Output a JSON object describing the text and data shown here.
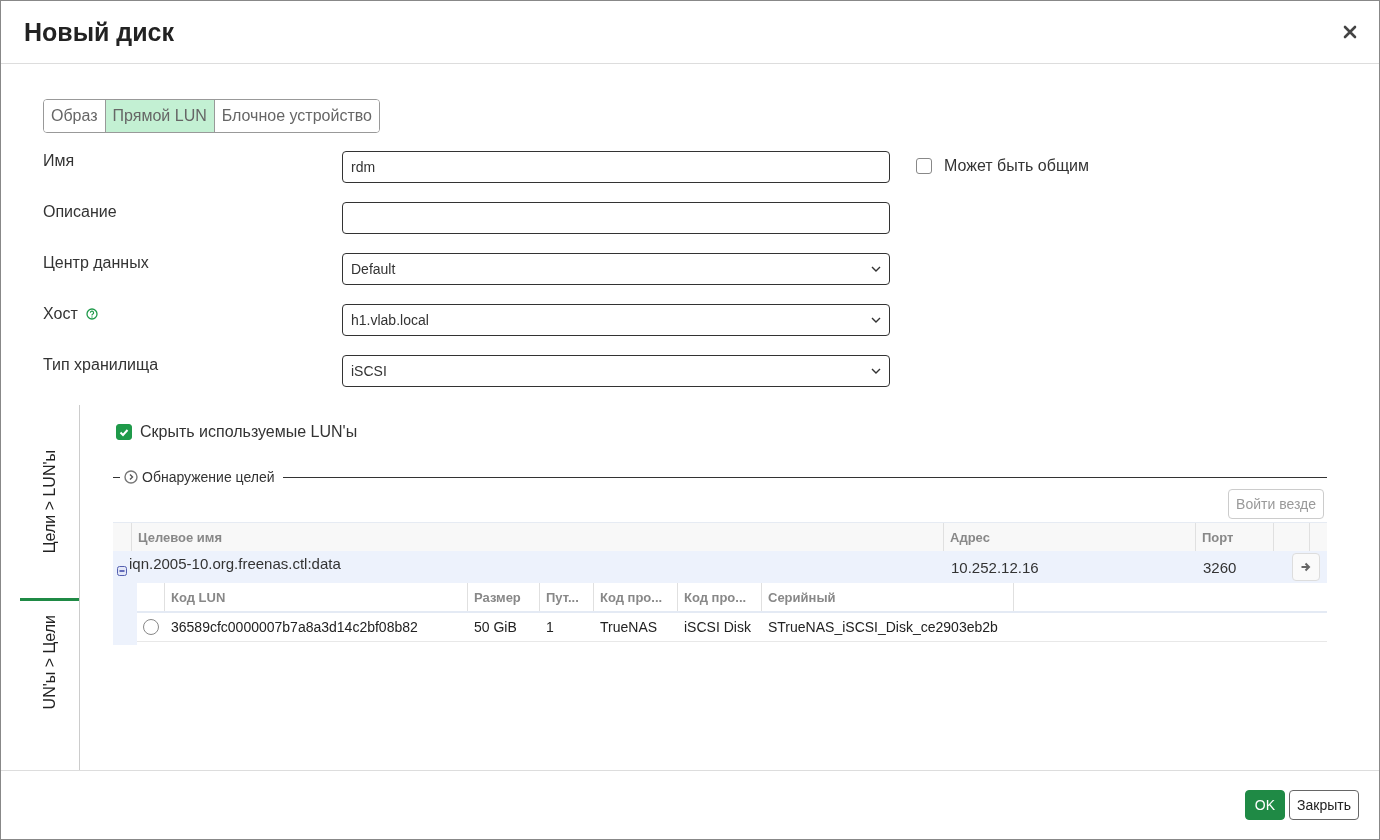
{
  "window": {
    "title": "Новый диск"
  },
  "disk_type_tabs": [
    {
      "label": "Образ",
      "selected": false
    },
    {
      "label": "Прямой LUN",
      "selected": true
    },
    {
      "label": "Блочное устройство",
      "selected": false
    }
  ],
  "form": {
    "fields": [
      {
        "label": "Имя",
        "kind": "text",
        "value": "rdm"
      },
      {
        "label": "Описание",
        "kind": "text"
      },
      {
        "label": "Центр данных",
        "kind": "select",
        "value": "Default"
      },
      {
        "label": "Хост",
        "kind": "select",
        "value": "h1.vlab.local",
        "help": true
      },
      {
        "label": "Тип хранилища",
        "kind": "select",
        "value": "iSCSI"
      }
    ],
    "shareable": {
      "label": "Может быть общим",
      "checked": false
    }
  },
  "side_tabs": [
    {
      "label": "Цели > LUN'ы",
      "selected": true
    },
    {
      "label": "UN'ы > Цели",
      "selected": false
    }
  ],
  "hide_used": {
    "label": "Скрыть используемые LUN'ы",
    "checked": true
  },
  "discovery": {
    "label": "Обнаружение целей",
    "expanded": false
  },
  "login_all_button": {
    "label": "Войти везде",
    "disabled": true
  },
  "targets": {
    "columns": [
      "Целевое имя",
      "Адрес",
      "Порт"
    ],
    "rows": [
      {
        "name": "iqn.2005-10.org.freenas.ctl:data",
        "address": "10.252.12.16",
        "port": "3260",
        "expanded": true,
        "luns": {
          "columns": [
            "Код LUN",
            "Размер",
            "Пут...",
            "Код про...",
            "Код про...",
            "Серийный"
          ],
          "rows": [
            {
              "selected": false,
              "cells": [
                "36589cfc0000007b7a8a3d14c2bf08b82",
                "50 GiB",
                "1",
                "TrueNAS",
                "iSCSI Disk",
                "STrueNAS_iSCSI_Disk_ce2903eb2b"
              ]
            }
          ]
        }
      }
    ]
  },
  "buttons": [
    {
      "label": "OK",
      "kind": "primary"
    },
    {
      "label": "Закрыть",
      "kind": "default"
    }
  ]
}
